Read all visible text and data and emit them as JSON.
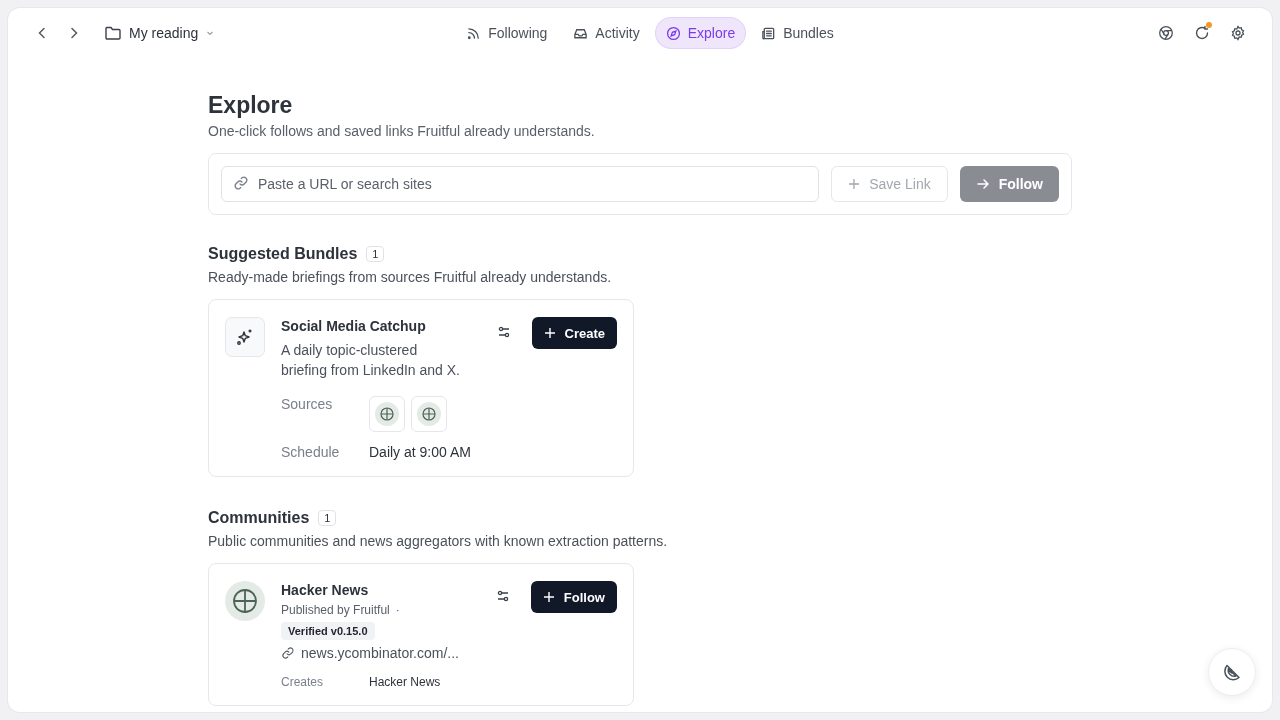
{
  "topbar": {
    "folder": "My reading",
    "notification": true
  },
  "tabs": [
    {
      "label": "Following",
      "selected": false
    },
    {
      "label": "Activity",
      "selected": false
    },
    {
      "label": "Explore",
      "selected": true
    },
    {
      "label": "Bundles",
      "selected": false
    }
  ],
  "header": {
    "title": "Explore",
    "subtitle": "One-click follows and saved links Fruitful already understands."
  },
  "search": {
    "placeholder": "Paste a URL or search sites",
    "save_label": "Save Link",
    "follow_label": "Follow",
    "follow_disabled": true
  },
  "bundles": {
    "title": "Suggested Bundles",
    "count": "1",
    "subtitle": "Ready-made briefings from sources Fruitful already understands.",
    "items": [
      {
        "name": "Social Media Catchup",
        "description": "A daily topic-clustered briefing from LinkedIn and X.",
        "action": "Create",
        "sources_label": "Sources",
        "sources": [
          {
            "kind": "globe"
          },
          {
            "kind": "globe"
          }
        ],
        "schedule_label": "Schedule",
        "schedule": "Daily at 9:00 AM"
      }
    ]
  },
  "communities": {
    "title": "Communities",
    "count": "1",
    "subtitle": "Public communities and news aggregators with known extraction patterns.",
    "items": [
      {
        "name": "Hacker News",
        "publisher": "Published by Fruitful",
        "separator": "·",
        "badge": "Verified v0.15.0",
        "url": "news.ycombinator.com/...",
        "action": "Follow",
        "creates_label": "Creates",
        "creates": "Hacker News"
      }
    ]
  }
}
